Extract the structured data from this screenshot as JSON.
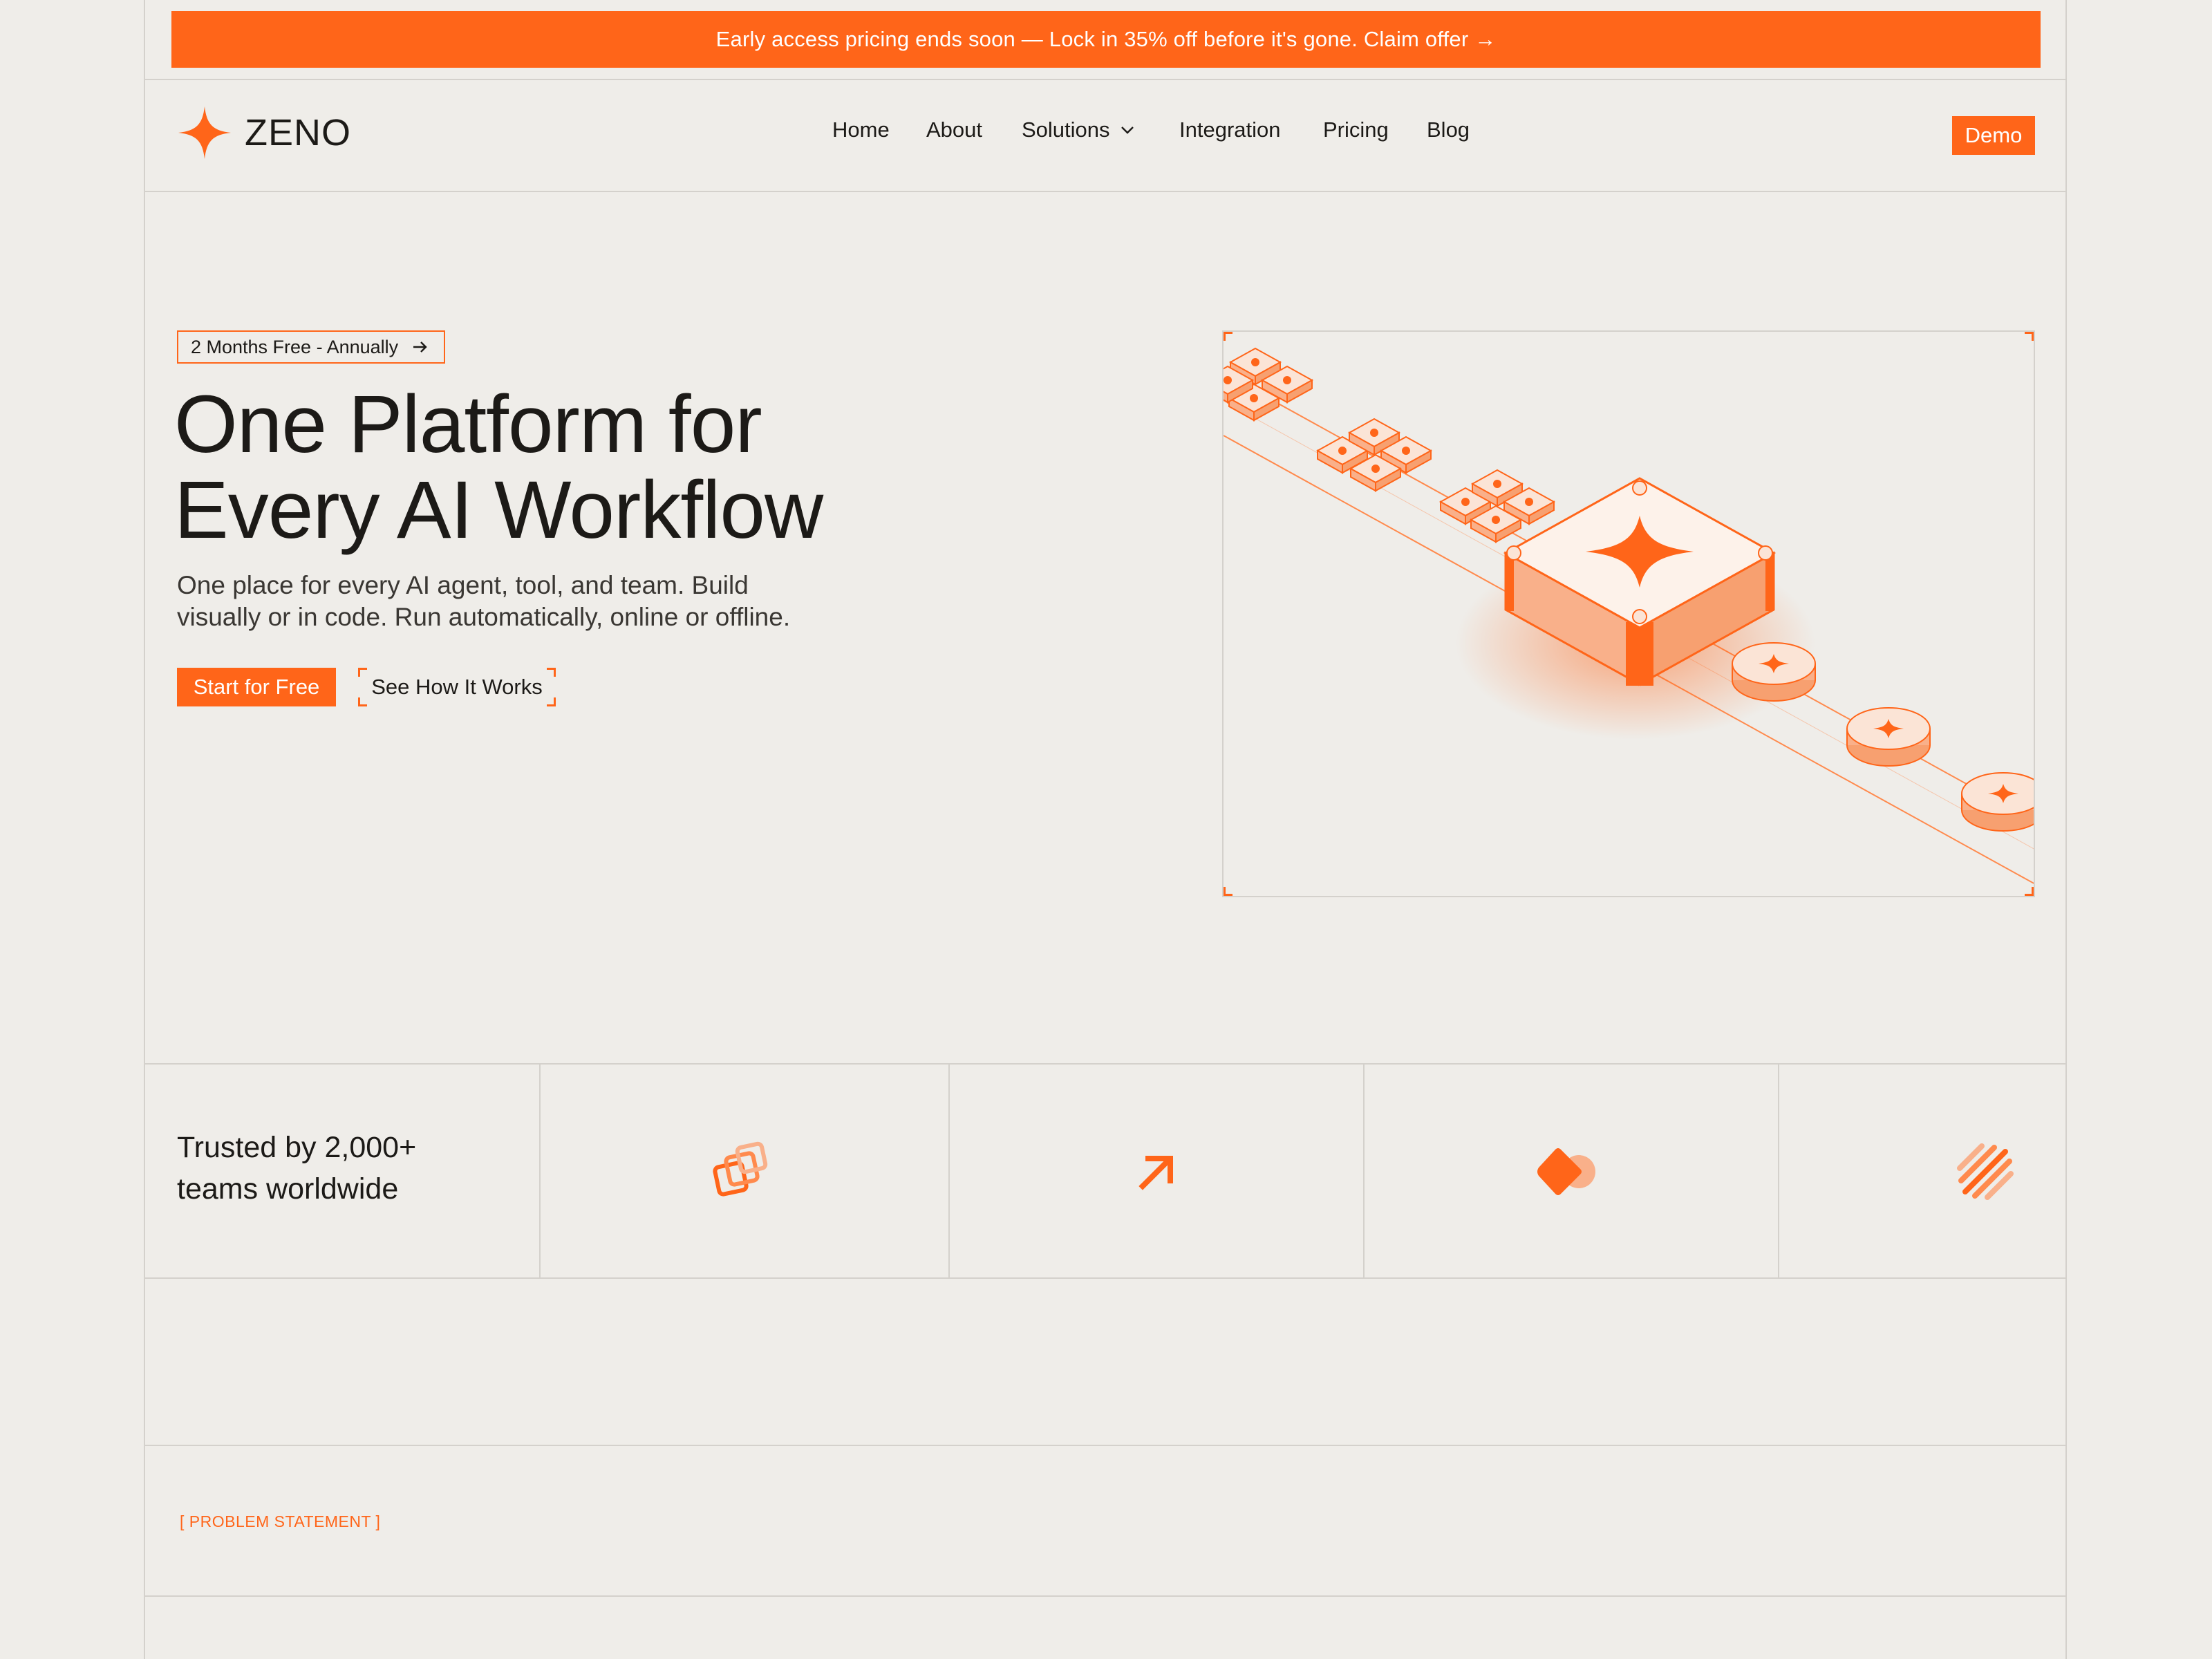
{
  "announcement": {
    "text": "Early access pricing ends soon — Lock in 35% off before it's gone. Claim offer →"
  },
  "brand": {
    "name": "ZENO",
    "accent": "#ff6519"
  },
  "nav": {
    "items": [
      {
        "label": "Home"
      },
      {
        "label": "About"
      },
      {
        "label": "Solutions"
      },
      {
        "label": "Integration"
      },
      {
        "label": "Pricing"
      },
      {
        "label": "Blog"
      }
    ],
    "demo_label": "Demo"
  },
  "hero": {
    "badge": "2 Months Free - Annually",
    "title_line1": "One Platform for",
    "title_line2": "Every AI Workflow",
    "subtitle_line1": "One place for every AI agent, tool, and team. Build",
    "subtitle_line2": "visually or in code. Run automatically, online or offline.",
    "primary_cta": "Start for Free",
    "secondary_cta": "See How It Works"
  },
  "trust": {
    "line1": "Trusted by 2,000+",
    "line2": "teams worldwide",
    "logos": [
      "stacked-squares-logo",
      "arrow-logo",
      "blob-logo",
      "slashes-logo"
    ]
  },
  "problem": {
    "label": "[ PROBLEM STATEMENT ]"
  }
}
